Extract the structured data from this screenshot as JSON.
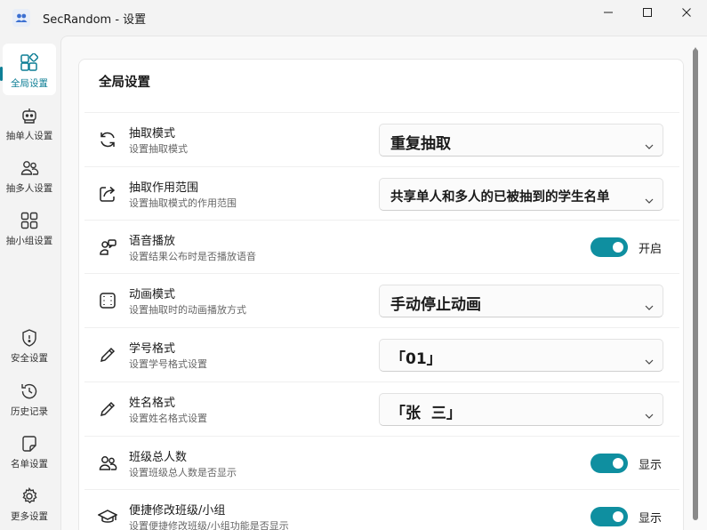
{
  "window": {
    "title": "SecRandom - 设置",
    "icon": "people-icon",
    "accent_color": "#0f8fa0"
  },
  "sidebar": {
    "items": [
      {
        "label": "全局设置",
        "icon": "grid-icon",
        "active": true
      },
      {
        "label": "抽单人设置",
        "icon": "robot-icon",
        "active": false
      },
      {
        "label": "抽多人设置",
        "icon": "people-icon",
        "active": false
      },
      {
        "label": "抽小组设置",
        "icon": "group-grid-icon",
        "active": false
      },
      {
        "label": "安全设置",
        "icon": "shield-icon",
        "active": false
      },
      {
        "label": "历史记录",
        "icon": "history-icon",
        "active": false
      },
      {
        "label": "名单设置",
        "icon": "note-icon",
        "active": false
      },
      {
        "label": "更多设置",
        "icon": "gear-icon",
        "active": false
      }
    ]
  },
  "main": {
    "card_title": "全局设置",
    "rows": [
      {
        "title": "抽取模式",
        "desc": "设置抽取模式",
        "control": "dropdown",
        "value": "重复抽取",
        "icon": "refresh-icon"
      },
      {
        "title": "抽取作用范围",
        "desc": "设置抽取模式的作用范围",
        "control": "dropdown",
        "value": "共享单人和多人的已被抽到的学生名单",
        "icon": "share-icon"
      },
      {
        "title": "语音播放",
        "desc": "设置结果公布时是否播放语音",
        "control": "toggle",
        "value": "开启",
        "icon": "speech-icon"
      },
      {
        "title": "动画模式",
        "desc": "设置抽取时的动画播放方式",
        "control": "dropdown",
        "value": "手动停止动画",
        "icon": "film-icon"
      },
      {
        "title": "学号格式",
        "desc": "设置学号格式设置",
        "control": "dropdown",
        "value": "「01」",
        "icon": "pen-icon"
      },
      {
        "title": "姓名格式",
        "desc": "设置姓名格式设置",
        "control": "dropdown",
        "value": "「张  三」",
        "icon": "pen-icon"
      },
      {
        "title": "班级总人数",
        "desc": "设置班级总人数是否显示",
        "control": "toggle",
        "value": "显示",
        "icon": "people-icon"
      },
      {
        "title": "便捷修改班级/小组",
        "desc": "设置便捷修改班级/小组功能是否显示",
        "control": "toggle",
        "value": "显示",
        "icon": "graduation-cap-icon"
      }
    ]
  }
}
